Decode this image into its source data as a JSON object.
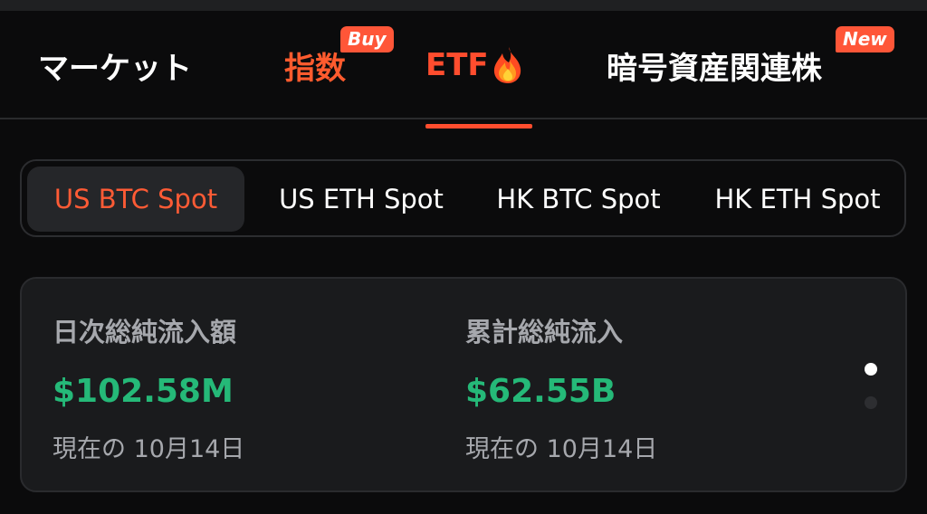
{
  "top_nav": {
    "tabs": [
      {
        "label": "マーケット",
        "state": "default"
      },
      {
        "label": "指数",
        "state": "highlighted",
        "badge": "Buy"
      },
      {
        "label": "ETF",
        "state": "active",
        "icon": "flame-icon"
      },
      {
        "label": "暗号資産関連株",
        "state": "default",
        "badge": "New"
      }
    ]
  },
  "etf_segments": {
    "items": [
      {
        "label": "US BTC Spot",
        "selected": true
      },
      {
        "label": "US ETH Spot",
        "selected": false
      },
      {
        "label": "HK BTC Spot",
        "selected": false
      },
      {
        "label": "HK ETH Spot",
        "selected": false
      }
    ]
  },
  "flow_card": {
    "daily": {
      "label": "日次総純流入額",
      "value": "$102.58M",
      "date": "現在の 10月14日"
    },
    "cumulative": {
      "label": "累計総純流入",
      "value": "$62.55B",
      "date": "現在の 10月14日"
    },
    "pagination": {
      "current_page": 1,
      "total_pages": 2
    }
  },
  "colors": {
    "accent_orange": "#ff4d2e",
    "positive_green": "#25b978",
    "background": "#0b0b0c",
    "card_background": "#1a1b1d"
  }
}
